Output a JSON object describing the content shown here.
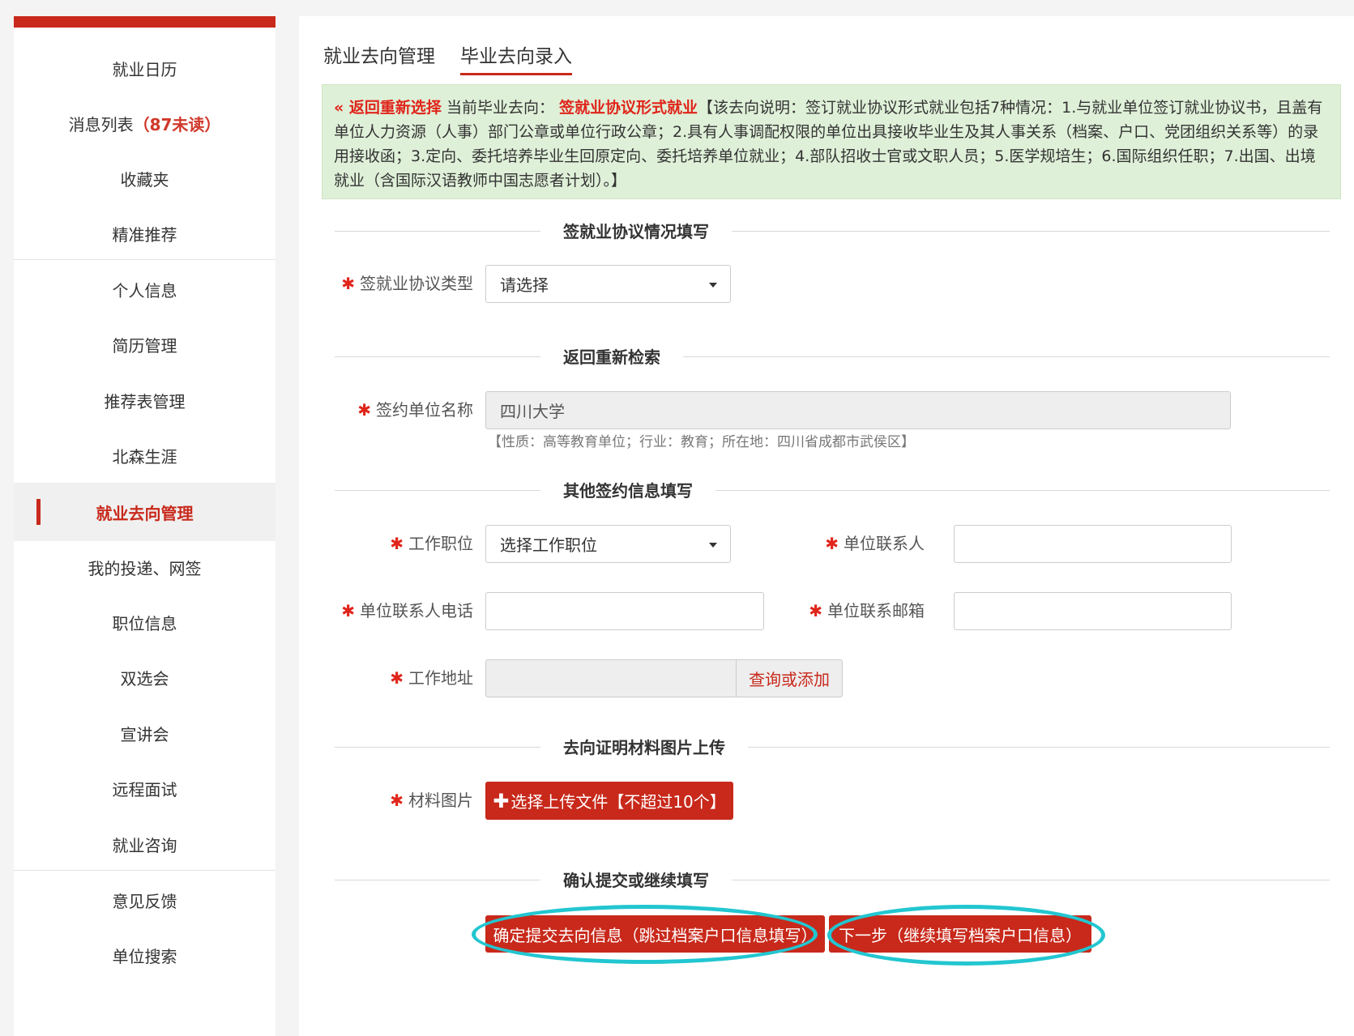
{
  "sidebar": {
    "items": [
      {
        "label": "就业日历"
      },
      {
        "label": "消息列表",
        "badge": "（87未读）"
      },
      {
        "label": "收藏夹"
      },
      {
        "label": "精准推荐"
      },
      {
        "label": "个人信息"
      },
      {
        "label": "简历管理"
      },
      {
        "label": "推荐表管理"
      },
      {
        "label": "北森生涯"
      },
      {
        "label": "就业去向管理",
        "active": true
      },
      {
        "label": "我的投递、网签"
      },
      {
        "label": "职位信息"
      },
      {
        "label": "双选会"
      },
      {
        "label": "宣讲会"
      },
      {
        "label": "远程面试"
      },
      {
        "label": "就业咨询"
      },
      {
        "label": "意见反馈"
      },
      {
        "label": "单位搜索"
      }
    ]
  },
  "tabs": [
    {
      "label": "就业去向管理",
      "active": false
    },
    {
      "label": "毕业去向录入",
      "active": true
    }
  ],
  "notice": {
    "back_link": "« 返回重新选择",
    "current_label": "当前毕业去向：",
    "destination": "签就业协议形式就业",
    "description": "【该去向说明：签订就业协议形式就业包括7种情况：1.与就业单位签订就业协议书，且盖有单位人力资源（人事）部门公章或单位行政公章；2.具有人事调配权限的单位出具接收毕业生及其人事关系（档案、户口、党团组织关系等）的录用接收函；3.定向、委托培养毕业生回原定向、委托培养单位就业；4.部队招收士官或文职人员；5.医学规培生；6.国际组织任职；7.出国、出境就业（含国际汉语教师中国志愿者计划）。】"
  },
  "sections": {
    "agreement": "签就业协议情况填写",
    "research": "返回重新检索",
    "other": "其他签约信息填写",
    "upload": "去向证明材料图片上传",
    "confirm": "确认提交或继续填写"
  },
  "form": {
    "agreement_type": {
      "label": "签就业协议类型",
      "value": "请选择"
    },
    "unit_name": {
      "label": "签约单位名称",
      "value": "四川大学",
      "hint": "【性质：高等教育单位；行业：教育；所在地：四川省成都市武侯区】"
    },
    "job_position": {
      "label": "工作职位",
      "value": "选择工作职位"
    },
    "contact_person": {
      "label": "单位联系人",
      "value": ""
    },
    "contact_phone": {
      "label": "单位联系人电话",
      "value": ""
    },
    "contact_email": {
      "label": "单位联系邮箱",
      "value": ""
    },
    "work_address": {
      "label": "工作地址",
      "value": "",
      "button": "查询或添加"
    },
    "materials": {
      "label": "材料图片",
      "button": "选择上传文件【不超过10个】"
    }
  },
  "actions": {
    "submit": "确定提交去向信息（跳过档案户口信息填写）",
    "next": "下一步（继续填写档案户口信息）"
  },
  "colors": {
    "brand": "#c8291b",
    "highlight_ring": "#22c6d0",
    "notice_bg": "#dff0d8"
  }
}
